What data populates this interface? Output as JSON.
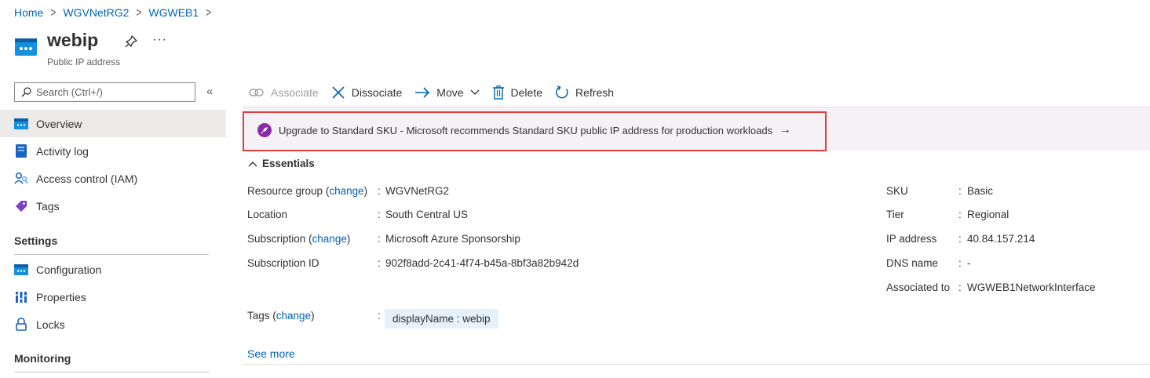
{
  "breadcrumb": [
    "Home",
    "WGVNetRG2",
    "WGWEB1"
  ],
  "resource": {
    "title": "webip",
    "subtitle": "Public IP address",
    "more": "···"
  },
  "sidebar": {
    "search_placeholder": "Search (Ctrl+/)",
    "collapse": "«",
    "items": [
      {
        "label": "Overview",
        "icon": "overview-icon"
      },
      {
        "label": "Activity log",
        "icon": "activity-log-icon"
      },
      {
        "label": "Access control (IAM)",
        "icon": "iam-icon"
      },
      {
        "label": "Tags",
        "icon": "tag-icon"
      }
    ],
    "sections": [
      {
        "title": "Settings",
        "items": [
          {
            "label": "Configuration",
            "icon": "configuration-icon"
          },
          {
            "label": "Properties",
            "icon": "properties-icon"
          },
          {
            "label": "Locks",
            "icon": "lock-icon"
          }
        ]
      },
      {
        "title": "Monitoring",
        "items": []
      }
    ]
  },
  "toolbar": {
    "associate": "Associate",
    "dissociate": "Dissociate",
    "move": "Move",
    "delete": "Delete",
    "refresh": "Refresh"
  },
  "banner": {
    "text": "Upgrade to Standard SKU - Microsoft recommends Standard SKU public IP address for production workloads",
    "arrow": "→"
  },
  "essentials": {
    "title": "Essentials",
    "left": {
      "resource_group": {
        "label": "Resource group",
        "change": "change",
        "value": "WGVNetRG2"
      },
      "location": {
        "label": "Location",
        "value": "South Central US"
      },
      "subscription": {
        "label": "Subscription",
        "change": "change",
        "value": "Microsoft Azure Sponsorship"
      },
      "subscription_id": {
        "label": "Subscription ID",
        "value": "902f8add-2c41-4f74-b45a-8bf3a82b942d"
      }
    },
    "right": {
      "sku": {
        "label": "SKU",
        "value": "Basic"
      },
      "tier": {
        "label": "Tier",
        "value": "Regional"
      },
      "ip_address": {
        "label": "IP address",
        "value": "40.84.157.214"
      },
      "dns_name": {
        "label": "DNS name",
        "value": "-"
      },
      "associated_to": {
        "label": "Associated to",
        "value": "WGWEB1NetworkInterface"
      }
    },
    "tags": {
      "label": "Tags",
      "change": "change",
      "value": "displayName : webip"
    },
    "see_more": "See more"
  },
  "colors": {
    "link": "#0062b8",
    "banner_bg": "#f6f0f7",
    "highlight_outline": "#e03d3d",
    "tag_chip_bg": "#e6f2fb"
  }
}
